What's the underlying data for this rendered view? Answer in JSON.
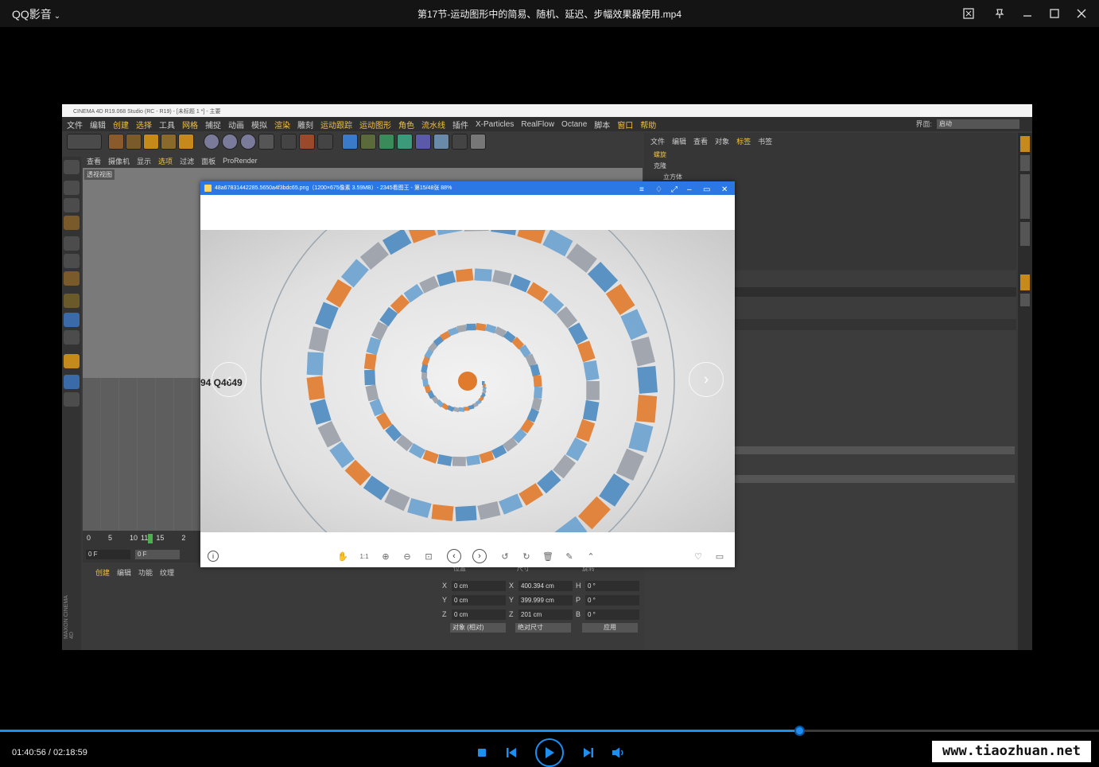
{
  "player": {
    "app_name": "QQ影音",
    "title": "第17节-运动图形中的简易、随机、延迟、步幅效果器使用.mp4",
    "current_time": "01:40:56",
    "total_time": "02:18:59",
    "time_text": "01:40:56 / 02:18:59",
    "progress": 0.727,
    "accent": "#1c8ff0"
  },
  "c4d": {
    "title": "CINEMA 4D R19.068 Studio (RC - R19) - [未标题 1 *] - 主要",
    "menus": [
      "文件",
      "编辑",
      "创建",
      "选择",
      "工具",
      "网格",
      "捕捉",
      "动画",
      "模拟",
      "渲染",
      "雕刻",
      "运动跟踪",
      "运动图形",
      "角色",
      "流水线",
      "插件",
      "X-Particles",
      "RealFlow",
      "Octane",
      "脚本",
      "窗口",
      "帮助"
    ],
    "interface_label": "界面:",
    "interface_value": "启动",
    "viewport_menus": [
      "查看",
      "摄像机",
      "显示",
      "选项",
      "过滤",
      "面板",
      "ProRender"
    ],
    "viewport_label": "透视视图",
    "timeline_ticks": [
      "0",
      "5",
      "10",
      "11",
      "15",
      "2"
    ],
    "frame_field": "0 F",
    "frame_field2": "0 F",
    "material_menus": [
      "创建",
      "编辑",
      "功能",
      "纹理"
    ],
    "object_menus": [
      "文件",
      "编辑",
      "查看",
      "对象",
      "标签",
      "书签"
    ],
    "objects": [
      "螺旋",
      "克隆",
      "立方体"
    ],
    "coord_headers": [
      "位置",
      "尺寸",
      "旋转"
    ],
    "coords": {
      "pos": [
        {
          "axis": "X",
          "value": "0 cm"
        },
        {
          "axis": "Y",
          "value": "0 cm"
        },
        {
          "axis": "Z",
          "value": "0 cm"
        }
      ],
      "size": [
        {
          "axis": "X",
          "value": "400.394 cm"
        },
        {
          "axis": "Y",
          "value": "399.999 cm"
        },
        {
          "axis": "Z",
          "value": "201 cm"
        }
      ],
      "rot": [
        {
          "axis": "H",
          "value": "0 °"
        },
        {
          "axis": "P",
          "value": "0 °"
        },
        {
          "axis": "B",
          "value": "0 °"
        }
      ]
    },
    "mode_dropdown": "对象 (相对)",
    "size_dropdown": "绝对尺寸",
    "apply_button": "应用",
    "maxon": "MAXON CINEMA 4D"
  },
  "viewer": {
    "title": "48a67831442285.5650a4f3bdc65.png（1200×675像素 3.59MB）- 2345看图王 - 第15/48张 88%",
    "prev_label": "94 Q4649",
    "accent": "#2b78e4"
  },
  "watermark": "www.tiaozhuan.net"
}
